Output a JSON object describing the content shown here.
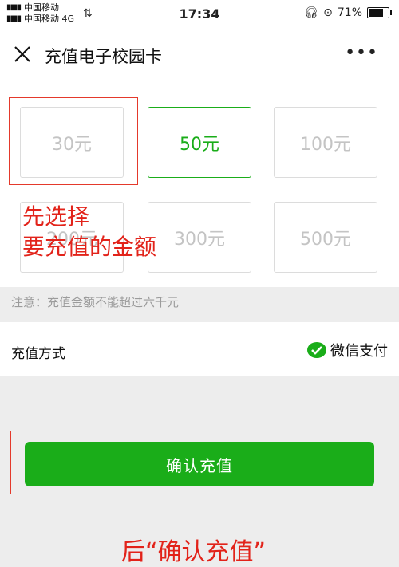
{
  "status_bar": {
    "carrier_1": "中国移动",
    "carrier_2": "中国移动 4G",
    "time": "17:34",
    "battery": "71%",
    "battery_level": 0.71
  },
  "nav": {
    "title": "充值电子校园卡",
    "more": "•••"
  },
  "amounts": [
    "30元",
    "50元",
    "100元",
    "200元",
    "300元",
    "500元"
  ],
  "selected_amount": "50元",
  "annotation_1": [
    "先选择",
    "要充值的金额"
  ],
  "note": "注意：充值金额不能超过六千元",
  "payment": {
    "label": "充值方式",
    "method": "微信支付"
  },
  "confirm_button": "确认充值",
  "annotation_2": "后“确认充值”",
  "colors": {
    "accent": "#1aad19",
    "annotation": "#e2231a",
    "page_bg": "#ededed"
  }
}
